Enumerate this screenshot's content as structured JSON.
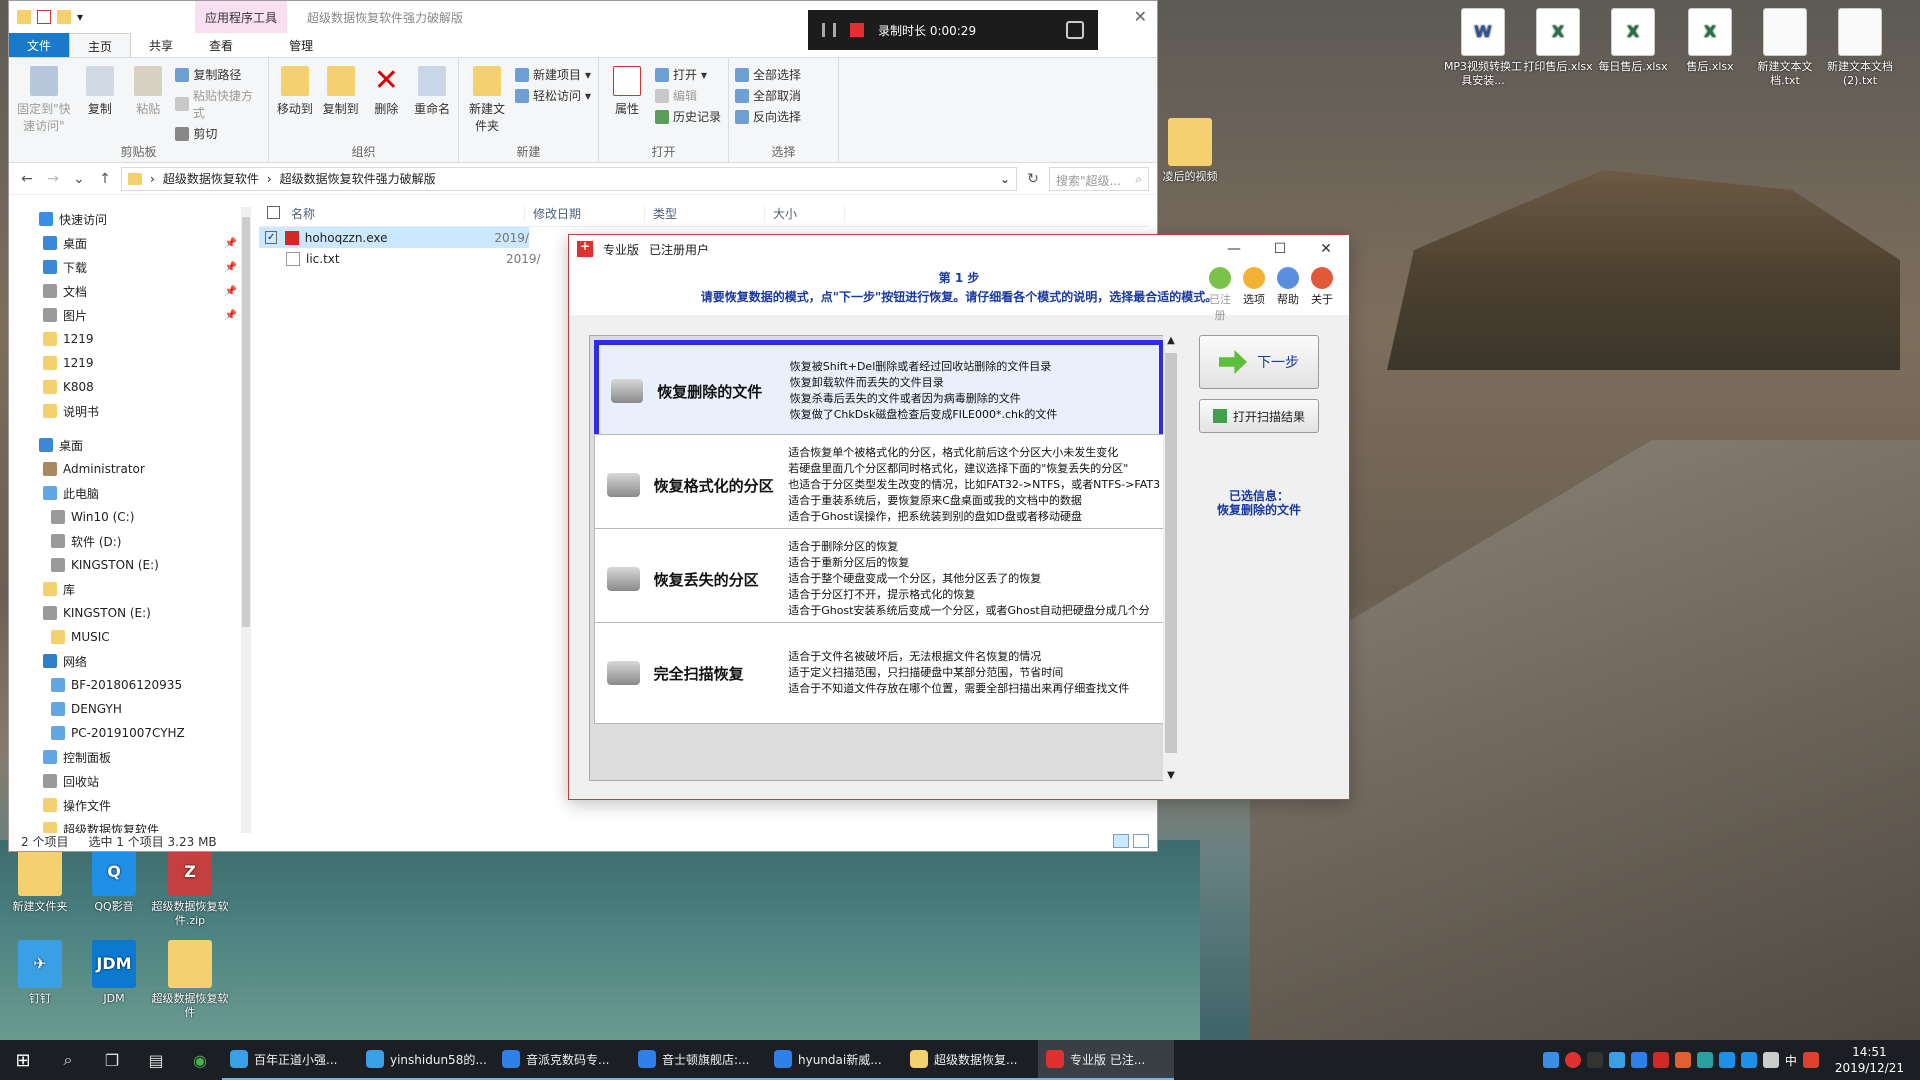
{
  "desktop": {
    "icons": [
      {
        "label": "MP3视频转换工具安装...",
        "type": "word"
      },
      {
        "label": "打印售后.xlsx",
        "type": "xls"
      },
      {
        "label": "每日售后.xlsx",
        "type": "xls"
      },
      {
        "label": "售后.xlsx",
        "type": "xls"
      },
      {
        "label": "新建文本文档.txt",
        "type": "txt"
      },
      {
        "label": "新建文本文档(2).txt",
        "type": "txt"
      },
      {
        "label": "凌后的视频",
        "type": "folder"
      },
      {
        "label": "新建文件夹",
        "type": "folder"
      },
      {
        "label": "QQ影音",
        "type": "qq"
      },
      {
        "label": "超级数据恢复软件.zip",
        "type": "zip"
      },
      {
        "label": "钉钉",
        "type": "bird"
      },
      {
        "label": "JDM",
        "type": "jdm"
      },
      {
        "label": "超级数据恢复软件",
        "type": "folder"
      }
    ]
  },
  "explorer": {
    "app_tools_label": "应用程序工具",
    "title": "超级数据恢复软件强力破解版",
    "tabs": [
      "文件",
      "主页",
      "共享",
      "查看",
      "管理"
    ],
    "ribbon": {
      "clipboard": {
        "pin": "固定到\"快速访问\"",
        "copy": "复制",
        "paste": "粘贴",
        "copy_path": "复制路径",
        "paste_shortcut": "粘贴快捷方式",
        "cut": "剪切",
        "group": "剪贴板"
      },
      "organize": {
        "move_to": "移动到",
        "copy_to": "复制到",
        "delete": "删除",
        "rename": "重命名",
        "group": "组织"
      },
      "new": {
        "new_item": "新建项目",
        "easy_access": "轻松访问",
        "new_folder": "新建文件夹",
        "group": "新建"
      },
      "open": {
        "properties": "属性",
        "open": "打开",
        "edit": "编辑",
        "history": "历史记录",
        "group": "打开"
      },
      "select": {
        "select_all": "全部选择",
        "select_none": "全部取消",
        "invert": "反向选择",
        "group": "选择"
      }
    },
    "breadcrumb": [
      "超级数据恢复软件",
      "超级数据恢复软件强力破解版"
    ],
    "search_placeholder": "搜索\"超级...",
    "nav": [
      {
        "label": "快速访问",
        "icon": "star",
        "level": 1
      },
      {
        "label": "桌面",
        "icon": "blue",
        "level": 2,
        "pinned": true
      },
      {
        "label": "下载",
        "icon": "blue",
        "level": 2,
        "pinned": true
      },
      {
        "label": "文档",
        "icon": "drive",
        "level": 2,
        "pinned": true
      },
      {
        "label": "图片",
        "icon": "drive",
        "level": 2,
        "pinned": true
      },
      {
        "label": "1219",
        "icon": "folder",
        "level": 2
      },
      {
        "label": "1219",
        "icon": "folder",
        "level": 2
      },
      {
        "label": "K808",
        "icon": "folder",
        "level": 2
      },
      {
        "label": "说明书",
        "icon": "folder",
        "level": 2
      },
      {
        "label": "",
        "icon": "",
        "level": 0
      },
      {
        "label": "桌面",
        "icon": "blue",
        "level": 1
      },
      {
        "label": "Administrator",
        "icon": "user",
        "level": 2
      },
      {
        "label": "此电脑",
        "icon": "pc",
        "level": 2
      },
      {
        "label": "Win10 (C:)",
        "icon": "drive",
        "level": 3
      },
      {
        "label": "软件 (D:)",
        "icon": "drive",
        "level": 3
      },
      {
        "label": "KINGSTON (E:)",
        "icon": "drive",
        "level": 3
      },
      {
        "label": "库",
        "icon": "folder",
        "level": 2
      },
      {
        "label": "KINGSTON (E:)",
        "icon": "drive",
        "level": 2
      },
      {
        "label": "MUSIC",
        "icon": "folder",
        "level": 3
      },
      {
        "label": "网络",
        "icon": "net",
        "level": 2
      },
      {
        "label": "BF-201806120935",
        "icon": "pc",
        "level": 3
      },
      {
        "label": "DENGYH",
        "icon": "pc",
        "level": 3
      },
      {
        "label": "PC-20191007CYHZ",
        "icon": "pc",
        "level": 3
      },
      {
        "label": "控制面板",
        "icon": "pc",
        "level": 2
      },
      {
        "label": "回收站",
        "icon": "drive",
        "level": 2
      },
      {
        "label": "操作文件",
        "icon": "folder",
        "level": 2
      },
      {
        "label": "超级数据恢复软件",
        "icon": "folder",
        "level": 2
      }
    ],
    "columns": [
      "名称",
      "修改日期",
      "类型",
      "大小"
    ],
    "files": [
      {
        "name": "hohoqzzn.exe",
        "date": "2019/",
        "type": "exe",
        "selected": true
      },
      {
        "name": "lic.txt",
        "date": "2019/",
        "type": "txt",
        "selected": false
      }
    ],
    "status": {
      "count": "2 个项目",
      "selected": "选中 1 个项目  3.23 MB"
    }
  },
  "recorder": {
    "duration": "录制时长 0:00:29"
  },
  "dialog": {
    "title_edition": "专业版",
    "title_user": "已注册用户",
    "step": "第 1 步",
    "instruction": "请要恢复数据的模式，点\"下一步\"按钮进行恢复。请仔细看各个模式的说明，选择最合适的模式。",
    "tools": [
      {
        "label": "已注册",
        "disabled": true,
        "color": "#7cc24a"
      },
      {
        "label": "选项",
        "disabled": false,
        "color": "#f2b233"
      },
      {
        "label": "帮助",
        "disabled": false,
        "color": "#5a8fe0"
      },
      {
        "label": "关于",
        "disabled": false,
        "color": "#e05a3a"
      }
    ],
    "modes": [
      {
        "name": "恢复删除的文件",
        "active": true,
        "desc": [
          "恢复被Shift+Del删除或者经过回收站删除的文件目录",
          "恢复卸载软件而丢失的文件目录",
          "恢复杀毒后丢失的文件或者因为病毒删除的文件",
          "恢复做了ChkDsk磁盘检查后变成FILE000*.chk的文件"
        ]
      },
      {
        "name": "恢复格式化的分区",
        "active": false,
        "desc": [
          "适合恢复单个被格式化的分区，格式化前后这个分区大小未发生变化",
          "若硬盘里面几个分区都同时格式化，建议选择下面的\"恢复丢失的分区\"",
          "也适合于分区类型发生改变的情况，比如FAT32->NTFS，或者NTFS->FAT3",
          "适合于重装系统后，要恢复原来C盘桌面或我的文档中的数据",
          "适合于Ghost误操作，把系统装到别的盘如D盘或者移动硬盘"
        ]
      },
      {
        "name": "恢复丢失的分区",
        "active": false,
        "desc": [
          "适合于删除分区的恢复",
          "适合于重新分区后的恢复",
          "适合于整个硬盘变成一个分区，其他分区丢了的恢复",
          "适合于分区打不开，提示格式化的恢复",
          "适合于Ghost安装系统后变成一个分区，或者Ghost自动把硬盘分成几个分"
        ]
      },
      {
        "name": "完全扫描恢复",
        "active": false,
        "desc": [
          "适合于文件名被破坏后，无法根据文件名恢复的情况",
          "适于定义扫描范围，只扫描硬盘中某部分范围，节省时间",
          "适合于不知道文件存放在哪个位置，需要全部扫描出来再仔细查找文件"
        ]
      }
    ],
    "next_label": "下一步",
    "open_scan_label": "打开扫描结果",
    "selected_info_label": "已选信息：",
    "selected_info_value": "恢复删除的文件"
  },
  "taskbar": {
    "apps": [
      {
        "label": "百年正道小强...",
        "color": "#3aa0e6"
      },
      {
        "label": "yinshidun58的...",
        "color": "#3aa0e6"
      },
      {
        "label": "音派克数码专...",
        "color": "#2f7fe8"
      },
      {
        "label": "音士顿旗舰店:...",
        "color": "#2f7fe8"
      },
      {
        "label": "hyundai新威...",
        "color": "#2f7fe8"
      },
      {
        "label": "超级数据恢复...",
        "color": "#f5d06f"
      },
      {
        "label": "专业版  已注...",
        "color": "#e03030"
      }
    ],
    "time": "14:51",
    "date": "2019/12/21",
    "ime": "中"
  }
}
